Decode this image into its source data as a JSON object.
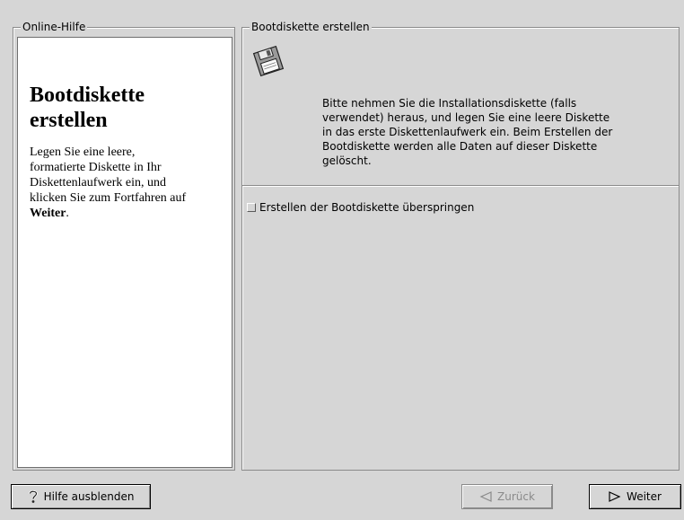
{
  "help_panel": {
    "title": "Online-Hilfe",
    "heading": "Bootdiskette erstellen",
    "text_prefix": "Legen Sie eine leere, formatierte Diskette in Ihr Diskettenlaufwerk ein, und klicken Sie zum Fortfahren auf ",
    "text_bold": "Weiter",
    "text_suffix": "."
  },
  "main_panel": {
    "title": "Bootdiskette erstellen",
    "icon": "floppy-disk-icon",
    "instructions": "Bitte nehmen Sie die Installationsdiskette (falls verwendet) heraus, und legen Sie eine leere Diskette in das erste Diskettenlaufwerk ein. Beim Erstellen der Bootdiskette werden alle Daten auf dieser Diskette gelöscht.",
    "skip_checkbox": {
      "label": "Erstellen der Bootdiskette überspringen",
      "checked": false
    }
  },
  "buttons": {
    "hide_help": {
      "label": "Hilfe ausblenden",
      "icon": "question-mark-icon"
    },
    "back": {
      "label": "Zurück",
      "icon": "left-triangle-icon",
      "enabled": false
    },
    "next": {
      "label": "Weiter",
      "icon": "right-triangle-icon",
      "enabled": true
    }
  }
}
